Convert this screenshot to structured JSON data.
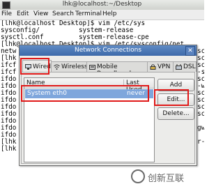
{
  "terminal": {
    "title": "lhk@localhost:~/Desktop",
    "menu": [
      {
        "label": "File"
      },
      {
        "label": "Edit"
      },
      {
        "label": "View"
      },
      {
        "label": "Search"
      },
      {
        "label": "Terminal"
      },
      {
        "label": "Help"
      }
    ],
    "lines": [
      "[lhk@localhost Desktop]$ vim /etc/sys",
      "sysconfig/          system-release",
      "sysctl.conf         system-release-cpe",
      "[lhk@localhost Desktop]$ vim /etc/sysconfig/net",
      "netw",
      "[lhk",
      "ifcf",
      "ifcf",
      "ifdo",
      "ifdo",
      "ifdo",
      "ifdo",
      "ifdo",
      "ifdo",
      "ifdo",
      "ifdo",
      "ifdo",
      "[lhk",
      "[lhk"
    ],
    "right_fragments": [
      {
        "text": "scr"
      },
      {
        "text": "scr"
      },
      {
        "text": "scr"
      },
      {
        "text": "-si"
      },
      {
        "text": "scr"
      },
      {
        "text": "-wi"
      },
      {
        "text": "scr"
      },
      {
        "text": "scr"
      },
      {
        "text": "scr"
      },
      {
        "text": "scr"
      },
      {
        "text": "gw"
      },
      {
        "text": "r-f"
      }
    ]
  },
  "dialog": {
    "title": "Network Connections",
    "close_glyph": "✕",
    "tabs": [
      {
        "label": "Wired",
        "icon": "wired-icon"
      },
      {
        "label": "Wireless",
        "icon": "wireless-icon"
      },
      {
        "label": "Mobile Broadband",
        "icon": "mobile-broadband-icon"
      },
      {
        "label": "VPN",
        "icon": "vpn-icon"
      },
      {
        "label": "DSL",
        "icon": "dsl-icon"
      }
    ],
    "table": {
      "columns": [
        "Name",
        "Last Used"
      ],
      "rows": [
        {
          "name": "System eth0",
          "last_used": "never"
        }
      ]
    },
    "buttons": {
      "add": "Add",
      "edit": "Edit...",
      "delete": "Delete..."
    }
  },
  "watermark": {
    "text": "创新互联"
  },
  "colors": {
    "selection": "#7ea6dc",
    "dialog_titlebar": "#4a76b6",
    "highlight": "#e01818"
  }
}
